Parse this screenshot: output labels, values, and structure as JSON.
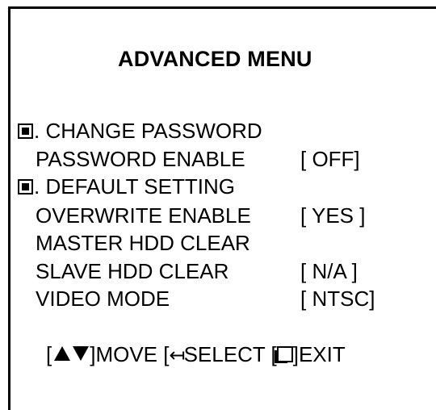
{
  "menu": {
    "title": "ADVANCED MENU",
    "items": [
      {
        "icon": "square-bullet-icon",
        "label": ". CHANGE PASSWORD",
        "value": ""
      },
      {
        "label": "PASSWORD ENABLE",
        "value": "[ OFF]"
      },
      {
        "icon": "square-bullet-icon",
        "label": ". DEFAULT SETTING",
        "value": ""
      },
      {
        "label": "OVERWRITE ENABLE",
        "value": "[ YES ]"
      },
      {
        "label": "MASTER HDD CLEAR",
        "value": ""
      },
      {
        "label": "SLAVE HDD CLEAR",
        "value": "[ N/A ]"
      },
      {
        "label": "VIDEO MODE",
        "value": "[ NTSC]"
      }
    ]
  },
  "footer": {
    "move_open": "[",
    "move_close": "]MOVE [",
    "enter_glyph": "↤",
    "select_text": "SELECT [",
    "exit_text": "]EXIT",
    "icons": [
      "up-arrow-icon",
      "down-arrow-icon",
      "enter-icon",
      "exit-icon"
    ]
  }
}
